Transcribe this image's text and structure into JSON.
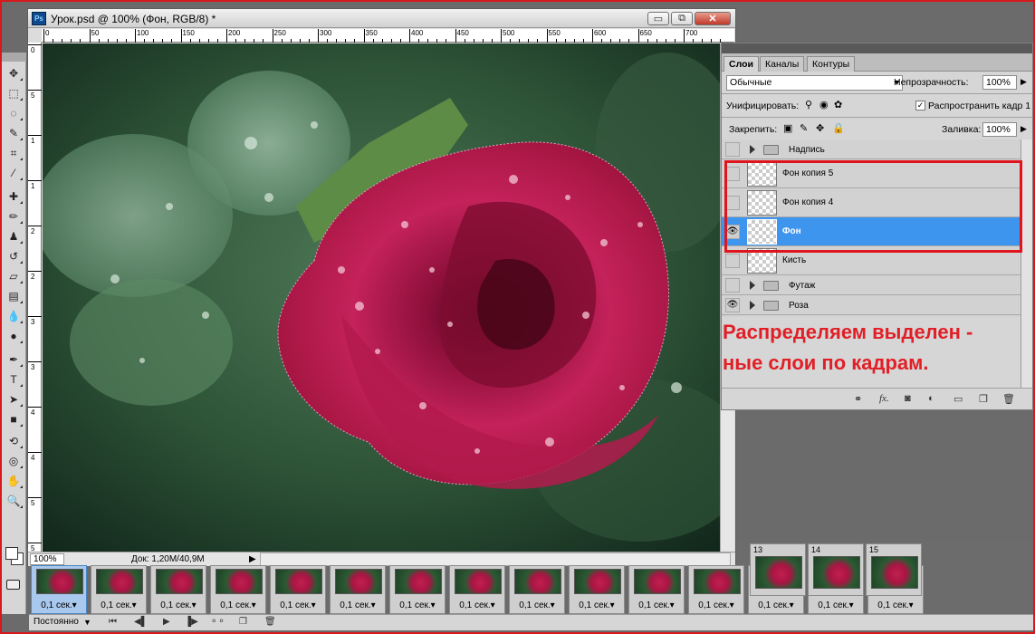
{
  "document": {
    "title": "Урок.psd @ 100% (Фон, RGB/8) *",
    "app_icon": "Ps",
    "zoom": "100%",
    "doc_info": "Док: 1,20M/40,9M",
    "ruler_top": [
      "0",
      "50",
      "100",
      "150",
      "200",
      "250",
      "300",
      "350",
      "400",
      "450",
      "500",
      "550",
      "600",
      "650",
      "700"
    ],
    "ruler_left": [
      "0",
      "5",
      "1",
      "1",
      "2",
      "2",
      "3",
      "3",
      "4",
      "4",
      "5",
      "5"
    ]
  },
  "window_buttons": {
    "minimize": "▭",
    "restore": "⧉",
    "close": "✕"
  },
  "layers_panel": {
    "tabs": [
      "Слои",
      "Каналы",
      "Контуры"
    ],
    "blend_mode": "Обычные",
    "opacity_label": "Непрозрачность:",
    "opacity_value": "100%",
    "unify_label": "Унифицировать:",
    "propagate_label": "Распространить кадр 1",
    "lock_label": "Закрепить:",
    "fill_label": "Заливка:",
    "fill_value": "100%",
    "layers": [
      {
        "name": "Надпись",
        "type": "group",
        "visible": false
      },
      {
        "name": "Фон копия 5",
        "type": "layer",
        "visible": false
      },
      {
        "name": "Фон копия 4",
        "type": "layer",
        "visible": false
      },
      {
        "name": "Фон",
        "type": "layer",
        "visible": true,
        "selected": true
      },
      {
        "name": "Кисть",
        "type": "layer",
        "visible": false
      },
      {
        "name": "Футаж",
        "type": "group",
        "visible": false
      },
      {
        "name": "Роза",
        "type": "group",
        "visible": true
      }
    ]
  },
  "annotation": {
    "line1": "Распределяем выделен -",
    "line2": "ные слои по кадрам."
  },
  "animation": {
    "frame_delay": "0,1 сек.",
    "frames_bottom_count": 15,
    "top_frames": [
      "13",
      "14",
      "15"
    ],
    "loop": "Постоянно"
  },
  "colors": {
    "accent_red": "#e11f26",
    "selection_blue": "#3d95ee"
  }
}
